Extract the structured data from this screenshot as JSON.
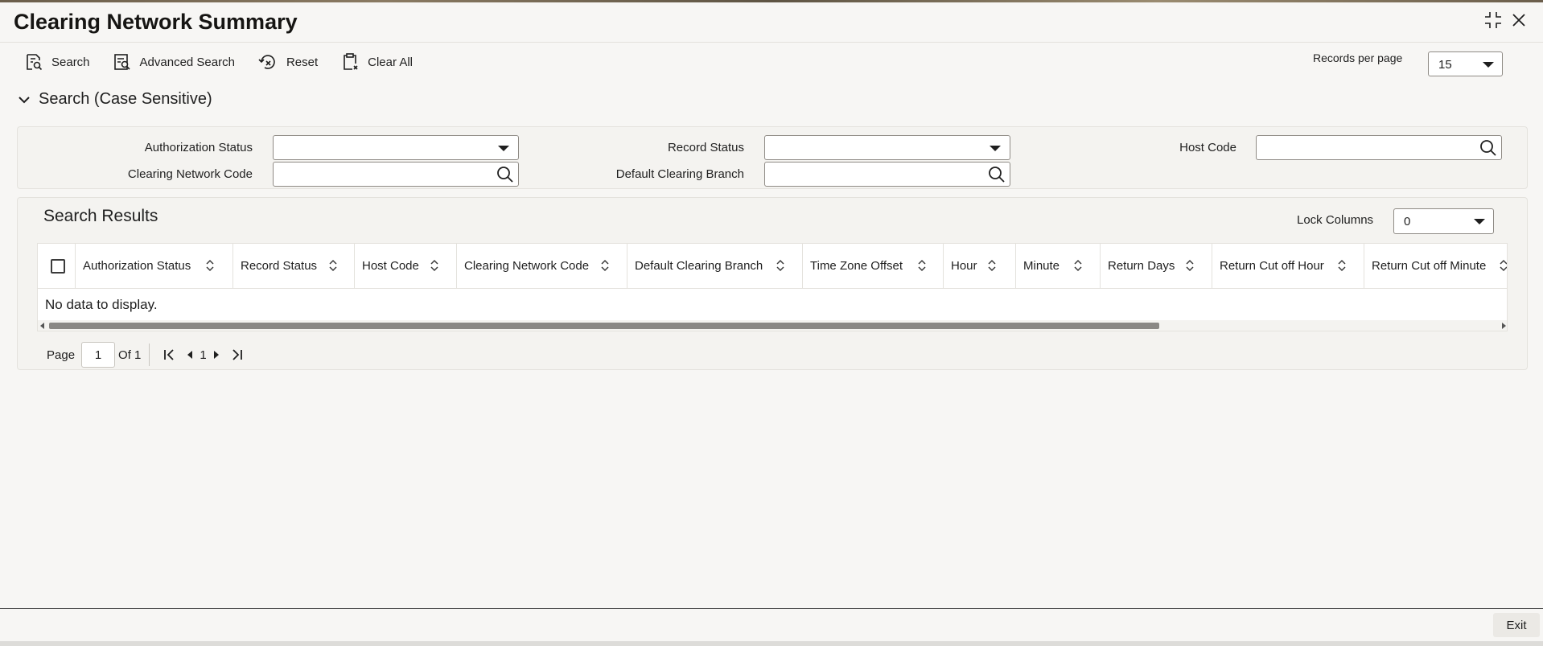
{
  "window": {
    "title": "Clearing Network Summary"
  },
  "toolbar": {
    "search_label": "Search",
    "advanced_search_label": "Advanced Search",
    "reset_label": "Reset",
    "clear_all_label": "Clear All",
    "records_per_page_label": "Records per page",
    "records_per_page_value": "15"
  },
  "search_section": {
    "title": "Search (Case Sensitive)",
    "fields": {
      "authorization_status": {
        "label": "Authorization Status",
        "value": ""
      },
      "record_status": {
        "label": "Record Status",
        "value": ""
      },
      "host_code": {
        "label": "Host Code",
        "value": ""
      },
      "clearing_network_code": {
        "label": "Clearing Network Code",
        "value": ""
      },
      "default_clearing_branch": {
        "label": "Default Clearing Branch",
        "value": ""
      }
    }
  },
  "results": {
    "title": "Search Results",
    "lock_columns_label": "Lock Columns",
    "lock_columns_value": "0",
    "columns": [
      "Authorization Status",
      "Record Status",
      "Host Code",
      "Clearing Network Code",
      "Default Clearing Branch",
      "Time Zone Offset",
      "Hour",
      "Minute",
      "Return Days",
      "Return Cut off Hour",
      "Return Cut off Minute"
    ],
    "empty_message": "No data to display."
  },
  "pagination": {
    "page_label": "Page",
    "current_page": "1",
    "of_label": "Of 1",
    "page_number": "1"
  },
  "footer": {
    "exit_label": "Exit"
  }
}
